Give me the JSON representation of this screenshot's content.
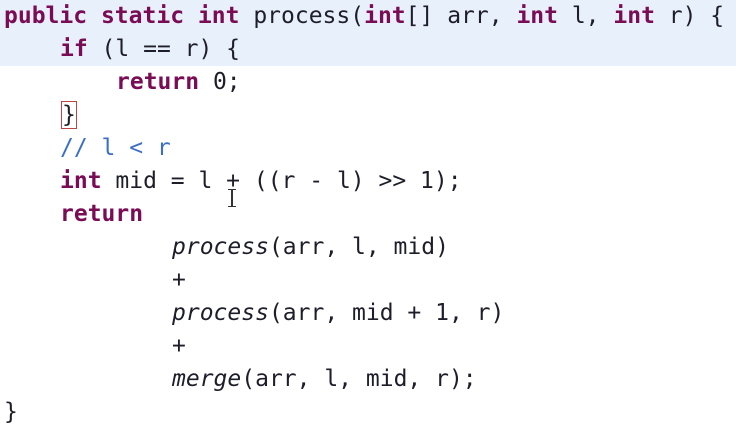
{
  "code": {
    "l1": {
      "kw1": "public",
      "kw2": "static",
      "kw3": "int",
      "name": "process",
      "p1t": "int",
      "p1rest": "[] arr, ",
      "p2t": "int",
      "p2rest": " l, ",
      "p3t": "int",
      "p3rest": " r) {"
    },
    "l2": {
      "kw": "if",
      "rest": " (l == r) {"
    },
    "l3": {
      "kw": "return",
      "rest": " 0;"
    },
    "l4": {
      "brace": "}"
    },
    "l5": {
      "comment": "// l < r"
    },
    "l6": {
      "kw": "int",
      "rest": " mid = l + ((r - l) >> 1);"
    },
    "l7": {
      "kw": "return"
    },
    "l8": {
      "fn": "process",
      "rest": "(arr, l, mid)"
    },
    "l9": {
      "op": "+"
    },
    "l10": {
      "fn": "process",
      "rest": "(arr, mid + 1, r)"
    },
    "l11": {
      "op": "+"
    },
    "l12": {
      "fn": "merge",
      "rest": "(arr, l, mid, r);"
    },
    "l13": {
      "brace": "}"
    }
  },
  "colors": {
    "keyword": "#7a0b55",
    "comment": "#3a6fc7",
    "text": "#1e1e2a",
    "current_line": "#e8f0fb",
    "bracket_match": "#b44"
  },
  "cursor": "text-ibeam"
}
